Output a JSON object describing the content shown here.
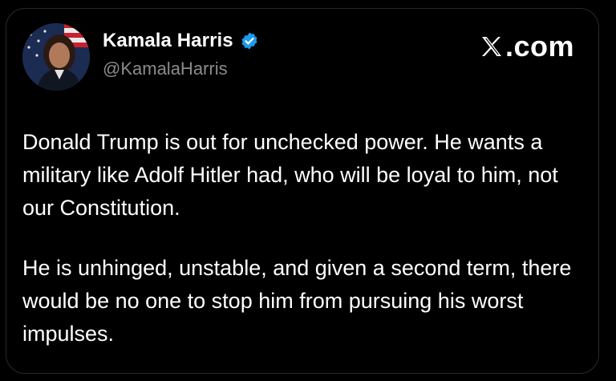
{
  "tweet": {
    "display_name": "Kamala Harris",
    "handle": "@KamalaHarris",
    "verified": true,
    "site": ".com",
    "paragraphs": [
      "Donald Trump is out for unchecked power. He wants a military like Adolf Hitler had, who will be loyal to him, not our Constitution.",
      "He is unhinged, unstable, and given a second term, there would be no one to stop him from pursuing his worst impulses."
    ]
  },
  "icons": {
    "verified": "verified-badge-icon",
    "logo": "x-logo-icon"
  },
  "colors": {
    "background": "#000000",
    "text": "#ffffff",
    "handle": "#8b8b8b",
    "verified": "#1d9bf0"
  }
}
